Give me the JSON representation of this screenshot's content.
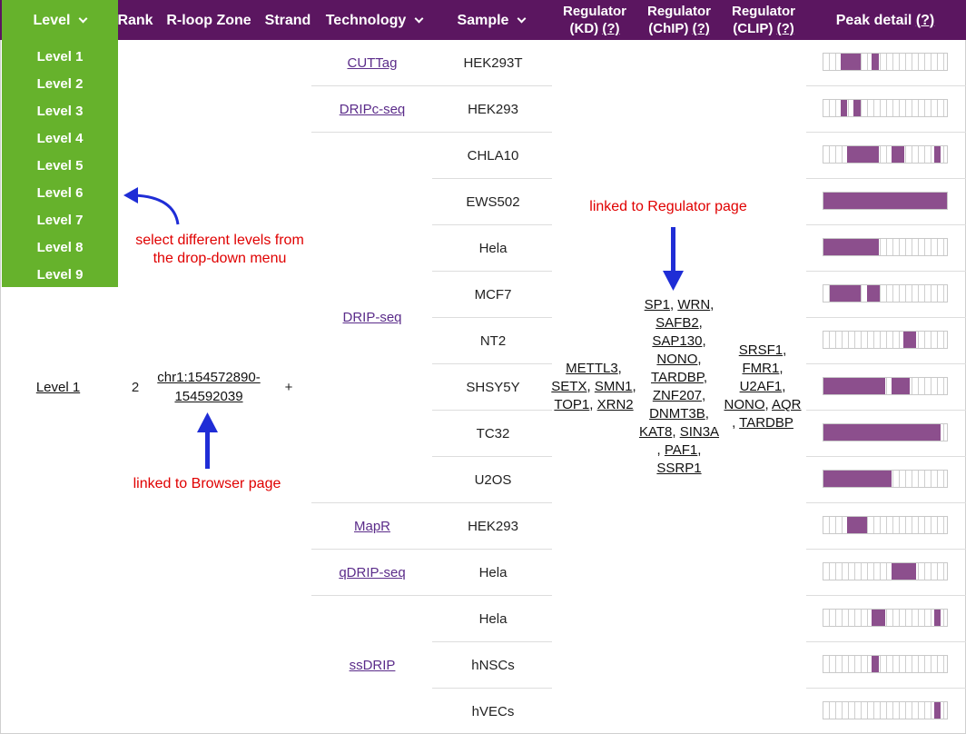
{
  "header": {
    "level": "Level",
    "rank": "Rank",
    "zone": "R-loop Zone",
    "strand": "Strand",
    "technology": "Technology",
    "sample": "Sample",
    "reg_kd_line1": "Regulator",
    "reg_kd_line2": "(KD)",
    "reg_chip_line1": "Regulator",
    "reg_chip_line2": "(ChIP)",
    "reg_clip_line1": "Regulator",
    "reg_clip_line2": "(CLIP)",
    "peak": "Peak detail",
    "help": "(?)"
  },
  "dropdown": [
    "Level 1",
    "Level 2",
    "Level 3",
    "Level 4",
    "Level 5",
    "Level 6",
    "Level 7",
    "Level 8",
    "Level 9"
  ],
  "row": {
    "level": "Level 1",
    "rank": "2",
    "zone_line1": "chr1:154572890-",
    "zone_line2": "154592039",
    "strand": "+"
  },
  "technologies": [
    "CUTTag",
    "DRIPc-seq",
    "DRIP-seq",
    "MapR",
    "qDRIP-seq",
    "ssDRIP"
  ],
  "samples": [
    "HEK293T",
    "HEK293",
    "CHLA10",
    "EWS502",
    "Hela",
    "MCF7",
    "NT2",
    "SHSY5Y",
    "TC32",
    "U2OS",
    "HEK293",
    "Hela",
    "Hela",
    "hNSCs",
    "hVECs"
  ],
  "regulators": {
    "kd": [
      "METTL3",
      "SETX",
      "SMN1",
      "TOP1",
      "XRN2"
    ],
    "chip": [
      "SP1",
      "WRN",
      "SAFB2",
      "SAP130",
      "NONO",
      "TARDBP",
      "ZNF207",
      "DNMT3B",
      "KAT8",
      "SIN3A",
      "PAF1",
      "SSRP1"
    ],
    "clip": [
      "SRSF1",
      "FMR1",
      "U2AF1",
      "NONO",
      "AQR",
      "TARDBP"
    ]
  },
  "peaks": [
    [
      [
        0.14,
        0.3
      ],
      [
        0.39,
        0.45
      ]
    ],
    [
      [
        0.14,
        0.19
      ],
      [
        0.24,
        0.3
      ]
    ],
    [
      [
        0.19,
        0.45
      ],
      [
        0.55,
        0.65
      ],
      [
        0.9,
        0.95
      ]
    ],
    [
      [
        0.0,
        1.0
      ]
    ],
    [
      [
        0.0,
        0.45
      ]
    ],
    [
      [
        0.05,
        0.3
      ],
      [
        0.35,
        0.45
      ]
    ],
    [
      [
        0.65,
        0.75
      ]
    ],
    [
      [
        0.0,
        0.5
      ],
      [
        0.55,
        0.7
      ]
    ],
    [
      [
        0.0,
        0.95
      ]
    ],
    [
      [
        0.0,
        0.55
      ]
    ],
    [
      [
        0.19,
        0.35
      ]
    ],
    [
      [
        0.55,
        0.75
      ]
    ],
    [
      [
        0.39,
        0.5
      ],
      [
        0.9,
        0.95
      ]
    ],
    [
      [
        0.39,
        0.45
      ]
    ],
    [
      [
        0.9,
        0.95
      ]
    ]
  ],
  "annotations": {
    "dropdown_note_1": "select different levels from",
    "dropdown_note_2": "the drop-down menu",
    "regulator_note": "linked to Regulator page",
    "browser_note": "linked to Browser page"
  },
  "colors": {
    "header": "#5b1660",
    "level_green": "#66b22c",
    "peak_fill": "#8c4f8d",
    "link": "#5b2c8a",
    "annotation": "#e00000"
  }
}
